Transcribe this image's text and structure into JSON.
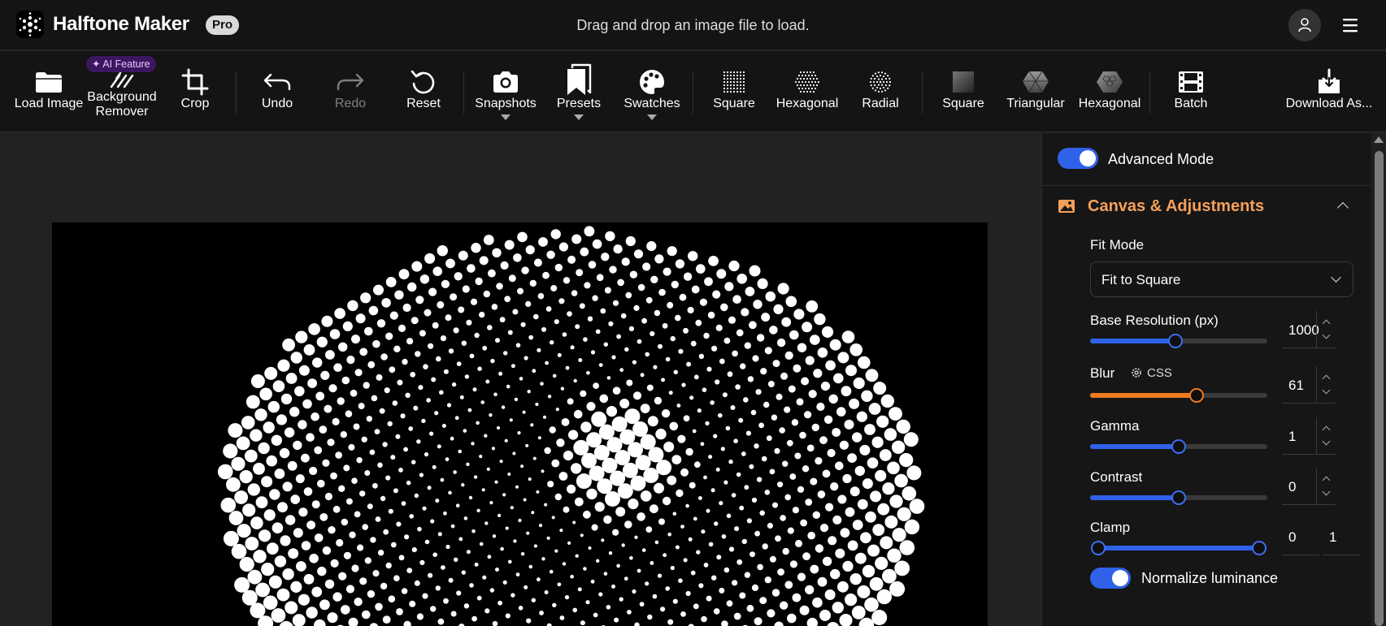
{
  "header": {
    "app_title": "Halftone Maker",
    "pro_badge": "Pro",
    "drop_hint": "Drag and drop an image file to load."
  },
  "toolbar": {
    "ai_badge": "AI Feature",
    "load_image": "Load Image",
    "background_remover_1": "Background",
    "background_remover_2": "Remover",
    "crop": "Crop",
    "undo": "Undo",
    "redo": "Redo",
    "reset": "Reset",
    "snapshots": "Snapshots",
    "presets": "Presets",
    "swatches": "Swatches",
    "dot_square": "Square",
    "dot_hexagonal": "Hexagonal",
    "dot_radial": "Radial",
    "grid_square": "Square",
    "grid_triangular": "Triangular",
    "grid_hexagonal": "Hexagonal",
    "batch": "Batch",
    "download": "Download As..."
  },
  "panel": {
    "advanced_mode_label": "Advanced Mode",
    "advanced_mode_on": true,
    "section_title": "Canvas & Adjustments",
    "section_color": "#f5a05a",
    "fit_mode_label": "Fit Mode",
    "fit_mode_value": "Fit to Square",
    "base_resolution_label": "Base Resolution (px)",
    "base_resolution_value": "1000",
    "base_resolution_fraction": 0.48,
    "blur_label": "Blur",
    "blur_css_label": "CSS",
    "blur_value": "61",
    "blur_fraction": 0.6,
    "gamma_label": "Gamma",
    "gamma_value": "1",
    "gamma_fraction": 0.5,
    "contrast_label": "Contrast",
    "contrast_value": "0",
    "contrast_fraction": 0.5,
    "clamp_label": "Clamp",
    "clamp_min": "0",
    "clamp_max": "1",
    "normalize_label": "Normalize luminance",
    "normalize_on": true
  },
  "colors": {
    "accent_blue": "#2f62e9",
    "accent_orange": "#f07b1f",
    "ai_purple": "#3d1660"
  }
}
